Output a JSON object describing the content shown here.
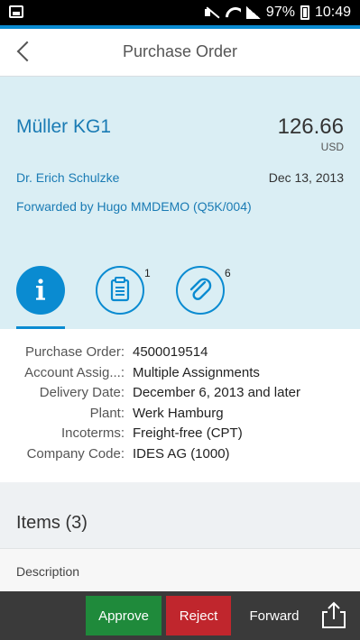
{
  "status_bar": {
    "battery": "97%",
    "time": "10:49",
    "icons": [
      "image-icon",
      "mute-icon",
      "wifi-icon",
      "signal-icon",
      "battery-icon"
    ]
  },
  "app_bar": {
    "title": "Purchase Order",
    "back_icon": "back-arrow-icon"
  },
  "header": {
    "vendor": "Müller KG1",
    "amount": "126.66",
    "currency": "USD",
    "person": "Dr. Erich Schulzke",
    "date": "Dec 13, 2013",
    "forwarded": "Forwarded by Hugo MMDEMO (Q5K/004)"
  },
  "tabs": [
    {
      "name": "info",
      "icon": "info-icon",
      "badge": ""
    },
    {
      "name": "notes",
      "icon": "notes-icon",
      "badge": "1"
    },
    {
      "name": "attachments",
      "icon": "paperclip-icon",
      "badge": "6"
    }
  ],
  "details": [
    {
      "label": "Purchase Order:",
      "value": "4500019514"
    },
    {
      "label": "Account Assig...:",
      "value": "Multiple Assignments"
    },
    {
      "label": "Delivery Date:",
      "value": "December 6, 2013 and later"
    },
    {
      "label": "Plant:",
      "value": "Werk Hamburg"
    },
    {
      "label": "Incoterms:",
      "value": "Freight-free (CPT)"
    },
    {
      "label": "Company Code:",
      "value": "IDES AG (1000)"
    }
  ],
  "items": {
    "title": "Items (3)",
    "column_header": "Description"
  },
  "footer": {
    "approve": "Approve",
    "reject": "Reject",
    "forward": "Forward",
    "share_icon": "share-icon"
  },
  "colors": {
    "accent": "#0a8bd1",
    "approve": "#1f8a3b",
    "reject": "#c0262d",
    "header_bg": "#daeef4",
    "footer_bg": "#3a3a3a"
  }
}
